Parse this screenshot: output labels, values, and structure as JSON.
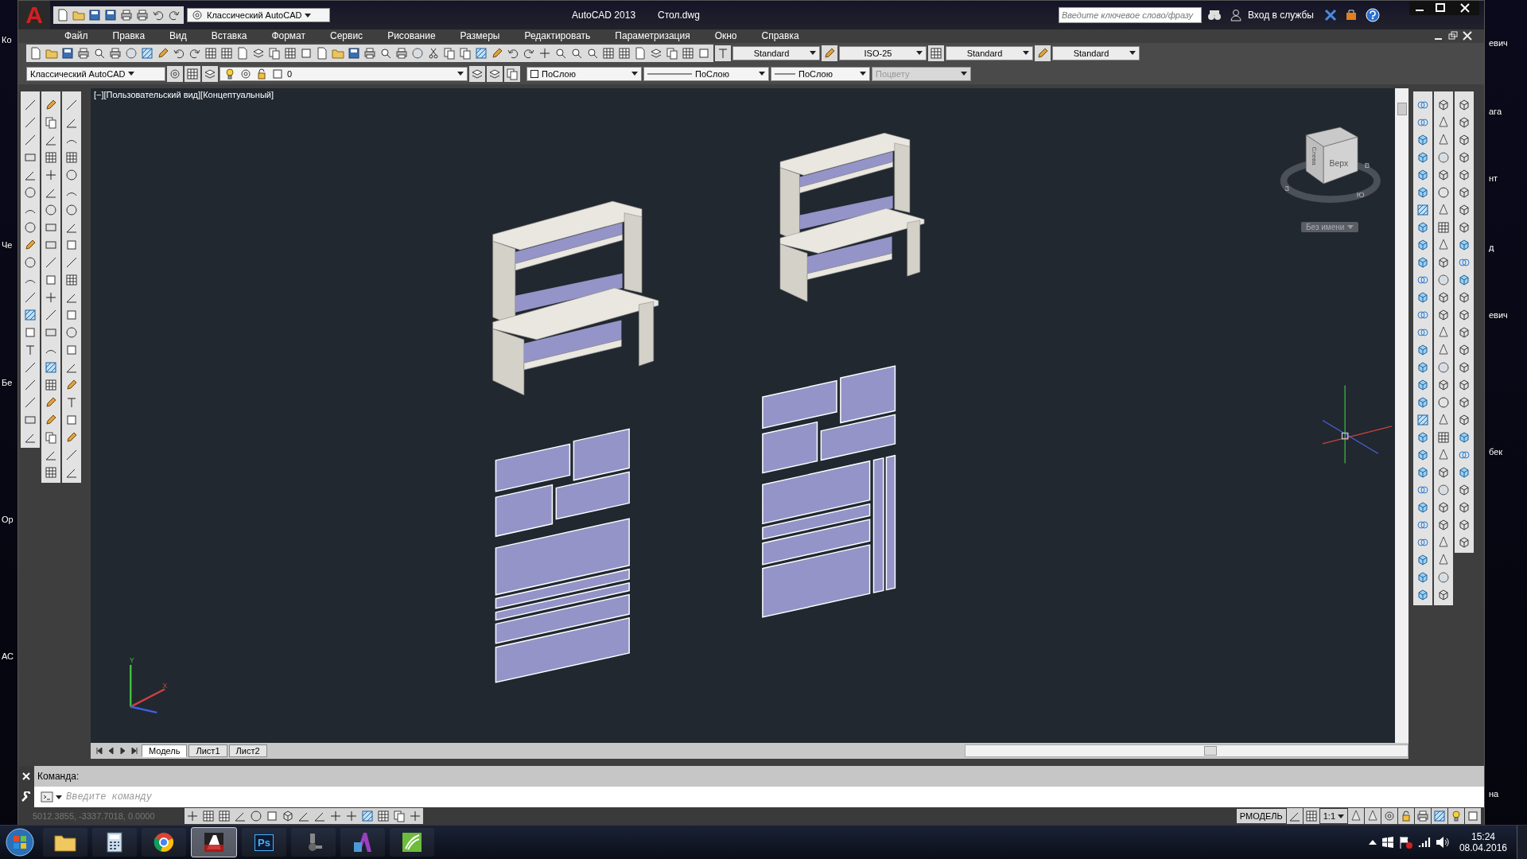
{
  "desktop": {
    "left_labels": [
      "Ко",
      "Че",
      "Бе",
      "Ор",
      "АС"
    ],
    "right_labels": [
      "евич",
      "ага",
      "нт",
      "д",
      "евич",
      "бек",
      "на"
    ]
  },
  "title_bar": {
    "logo": "A",
    "workspace": "Классический AutoCAD",
    "app_name": "AutoCAD 2013",
    "file_name": "Стол.dwg",
    "search": {
      "placeholder": "Введите ключевое слово/фразу"
    },
    "sign_in": "Вход в службы"
  },
  "menu": [
    "Файл",
    "Правка",
    "Вид",
    "Вставка",
    "Формат",
    "Сервис",
    "Рисование",
    "Размеры",
    "Редактировать",
    "Параметризация",
    "Окно",
    "Справка"
  ],
  "style_dropdowns": [
    "Standard",
    "ISO-25",
    "Standard",
    "Standard"
  ],
  "properties_bar": {
    "workspace": "Классический AutoCAD",
    "layer": "0",
    "color_mode": "ПоСлою",
    "linetype": "ПоСлою",
    "lineweight": "ПоСлою",
    "plot_style": {
      "value": "Поцвету",
      "disabled": true
    }
  },
  "viewport": {
    "label": "[−][Пользовательский вид][Концептуальный]",
    "viewcube": {
      "faces": [
        "Верх",
        "Слева"
      ],
      "compass": [
        "З",
        "В",
        "Ю"
      ]
    },
    "view_name": "Без имени",
    "ucs_labels": [
      "Y",
      "X"
    ]
  },
  "layout_tabs": [
    {
      "label": "Модель",
      "selected": true
    },
    {
      "label": "Лист1",
      "selected": false
    },
    {
      "label": "Лист2",
      "selected": false
    }
  ],
  "command_line": {
    "history": "Команда:",
    "placeholder": "Введите команду"
  },
  "status_bar": {
    "coordinates": "5012.3855, -3337.7018, 0.0000",
    "model_label": "РМОДЕЛЬ",
    "scale": "1:1"
  },
  "taskbar": {
    "apps": [
      {
        "kind": "folder",
        "selected": false
      },
      {
        "kind": "calculator",
        "selected": false
      },
      {
        "kind": "browser",
        "selected": false
      },
      {
        "kind": "cad",
        "selected": true
      },
      {
        "kind": "photo",
        "label": "Ps",
        "selected": false
      },
      {
        "kind": "tool",
        "selected": false
      },
      {
        "kind": "letter",
        "selected": false
      },
      {
        "kind": "vector",
        "selected": false
      }
    ],
    "time": "15:24",
    "date": "08.04.2016"
  }
}
